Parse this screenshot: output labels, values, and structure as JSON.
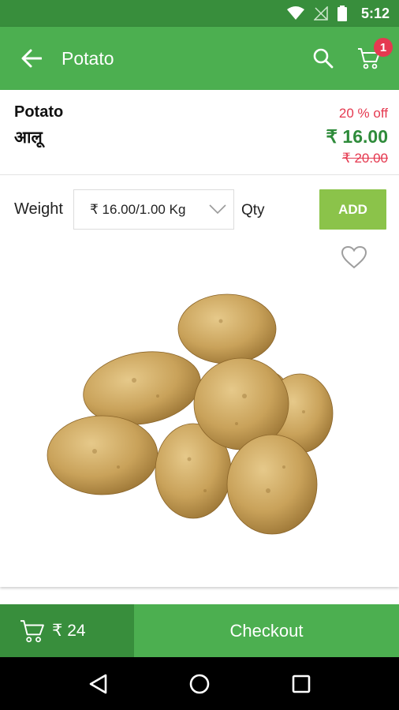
{
  "status_bar": {
    "time": "5:12"
  },
  "app_bar": {
    "title": "Potato",
    "cart_count": "1"
  },
  "product": {
    "name": "Potato",
    "name_hindi": "आलू",
    "discount": "20 % off",
    "price": "₹ 16.00",
    "mrp": "₹ 20.00"
  },
  "options": {
    "weight_label": "Weight",
    "weight_selected": "₹ 16.00/1.00 Kg",
    "qty_label": "Qty",
    "add_label": "ADD"
  },
  "bottom_bar": {
    "cart_total": "₹ 24",
    "checkout_label": "Checkout"
  },
  "colors": {
    "status_bar": "#388e3c",
    "app_bar": "#4caf50",
    "add_button": "#8bc34a",
    "discount_red": "#e53950",
    "price_green": "#2e8b3a"
  }
}
